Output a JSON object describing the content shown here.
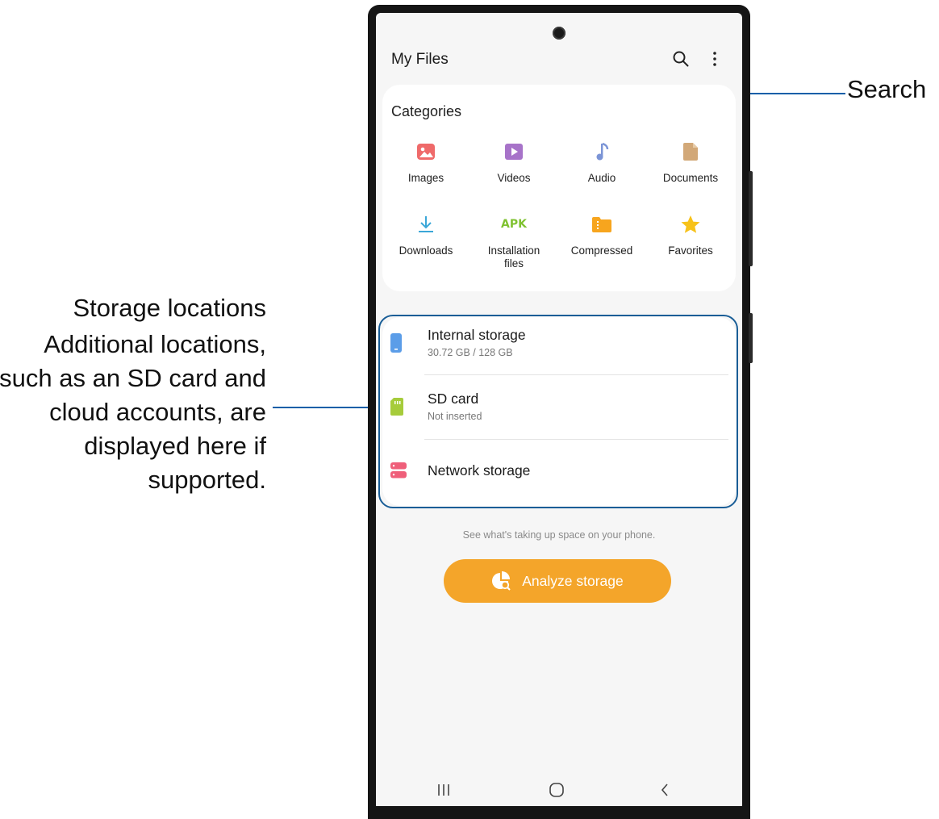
{
  "callouts": {
    "search": "Search",
    "storage_title": "Storage locations",
    "storage_body": "Additional locations, such as an SD card and cloud accounts, are displayed here if supported."
  },
  "header": {
    "title": "My Files",
    "search_icon": "search-icon",
    "more_icon": "more-vertical-icon"
  },
  "categories": {
    "heading": "Categories",
    "items": [
      {
        "label": "Images",
        "icon": "image-icon",
        "color": "#ef6a6a"
      },
      {
        "label": "Videos",
        "icon": "video-icon",
        "color": "#a773c9"
      },
      {
        "label": "Audio",
        "icon": "music-note-icon",
        "color": "#7b94d6"
      },
      {
        "label": "Documents",
        "icon": "document-icon",
        "color": "#d2a878"
      },
      {
        "label": "Downloads",
        "icon": "download-icon",
        "color": "#3ba7d8"
      },
      {
        "label": "Installation\nfiles",
        "icon": "apk-icon",
        "icon_text": "APK",
        "color": "#7fc231"
      },
      {
        "label": "Compressed",
        "icon": "folder-zip-icon",
        "color": "#f7a51e"
      },
      {
        "label": "Favorites",
        "icon": "star-icon",
        "color": "#f7c21a"
      }
    ]
  },
  "storage": {
    "items": [
      {
        "name": "Internal storage",
        "sub": "30.72 GB / 128 GB",
        "icon": "phone-storage-icon",
        "color": "#5b9de8"
      },
      {
        "name": "SD card",
        "sub": "Not inserted",
        "icon": "sd-card-icon",
        "color": "#a6cc3b"
      },
      {
        "name": "Network storage",
        "sub": "",
        "icon": "network-storage-icon",
        "color": "#ef5f7a"
      }
    ]
  },
  "analyze": {
    "hint": "See what's taking up space on your phone.",
    "button_label": "Analyze storage",
    "icon": "analyze-storage-icon",
    "color": "#f4a52a"
  },
  "navbar": {
    "recents_icon": "recents-icon",
    "home_icon": "home-icon",
    "back_icon": "back-icon"
  }
}
